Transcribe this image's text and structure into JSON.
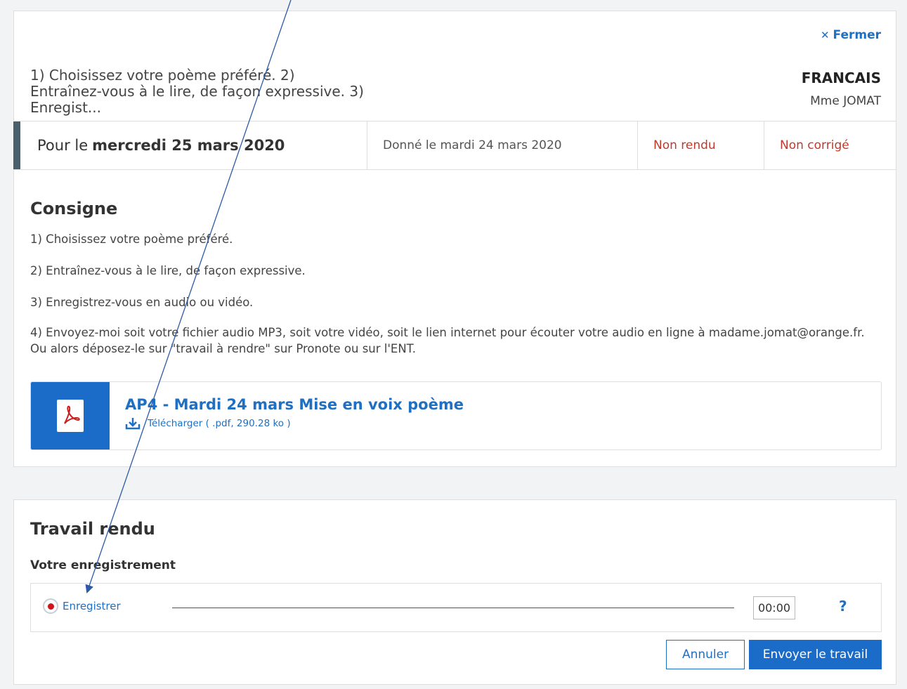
{
  "header": {
    "close_label": "Fermer",
    "close_icon": "close-icon",
    "short_title": "1) Choisissez votre poème préféré. 2) Entraînez-vous à le lire, de façon expressive. 3) Enregist...",
    "subject": "FRANCAIS",
    "teacher": "Mme JOMAT"
  },
  "info": {
    "due_prefix": "Pour le",
    "due_date": "mercredi 25 mars 2020",
    "given": "Donné le mardi 24 mars 2020",
    "status": "Non rendu",
    "correction": "Non corrigé",
    "status_color": "#c0392b"
  },
  "consigne": {
    "title": "Consigne",
    "lines": [
      "1) Choisissez votre poème préféré.",
      "2) Entraînez-vous à le lire, de façon expressive.",
      "3) Enregistrez-vous en audio ou vidéo.",
      "4) Envoyez-moi soit votre fichier audio MP3, soit votre vidéo, soit le lien internet pour écouter votre audio en ligne à madame.jomat@orange.fr.",
      "Ou alors déposez-le sur \"travail à rendre\" sur Pronote ou sur l'ENT."
    ]
  },
  "attachment": {
    "title": "AP4 - Mardi 24 mars Mise en voix poème",
    "download_label": "Télécharger ( .pdf, 290.28 ko )",
    "icon": "pdf-icon",
    "download_icon": "download-icon"
  },
  "work": {
    "title": "Travail rendu",
    "recording_label": "Votre enregistrement",
    "record_button": "Enregistrer",
    "timer": "00:00",
    "help": "?",
    "cancel": "Annuler",
    "send": "Envoyer le travail"
  },
  "colors": {
    "accent": "#1b6cc8",
    "link": "#1f6fc2",
    "due_bar": "#4a5f6b"
  }
}
